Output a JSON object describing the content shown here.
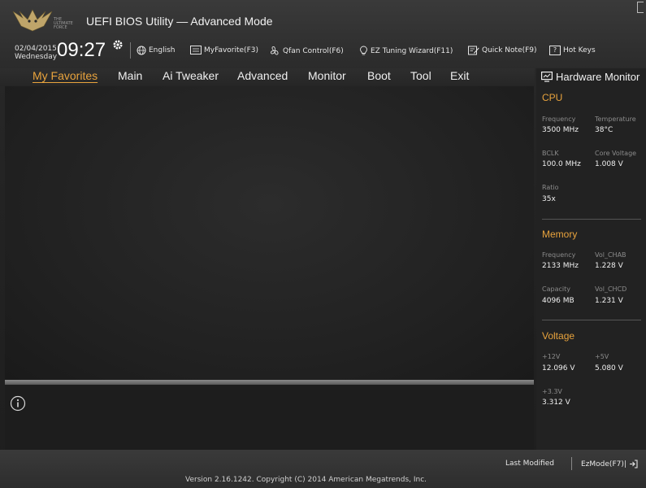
{
  "header": {
    "brand_small": "THE ULTIMATE FORCE",
    "app_title": "UEFI BIOS Utility — Advanced Mode"
  },
  "toolbar": {
    "date": "02/04/2015",
    "weekday": "Wednesday",
    "time": "09:27",
    "language": "English",
    "my_favorite": "MyFavorite(F3)",
    "qfan": "Qfan Control(F6)",
    "ez_tuning": "EZ Tuning Wizard(F11)",
    "quick_note": "Quick Note(F9)",
    "hot_keys": "Hot Keys",
    "hot_keys_key": "?"
  },
  "nav": {
    "items": [
      "My Favorites",
      "Main",
      "Ai Tweaker",
      "Advanced",
      "Monitor",
      "Boot",
      "Tool",
      "Exit"
    ],
    "active": "My Favorites"
  },
  "hardware_monitor": {
    "title": "Hardware Monitor",
    "cpu": {
      "heading": "CPU",
      "frequency_label": "Frequency",
      "frequency": "3500 MHz",
      "temperature_label": "Temperature",
      "temperature": "38°C",
      "bclk_label": "BCLK",
      "bclk": "100.0 MHz",
      "core_voltage_label": "Core Voltage",
      "core_voltage": "1.008 V",
      "ratio_label": "Ratio",
      "ratio": "35x"
    },
    "memory": {
      "heading": "Memory",
      "frequency_label": "Frequency",
      "frequency": "2133 MHz",
      "vol_chab_label": "Vol_CHAB",
      "vol_chab": "1.228 V",
      "capacity_label": "Capacity",
      "capacity": "4096 MB",
      "vol_chcd_label": "Vol_CHCD",
      "vol_chcd": "1.231 V"
    },
    "voltage": {
      "heading": "Voltage",
      "v12_label": "+12V",
      "v12": "12.096 V",
      "v5_label": "+5V",
      "v5": "5.080 V",
      "v33_label": "+3.3V",
      "v33": "3.312 V"
    }
  },
  "footer": {
    "last_modified": "Last Modified",
    "ez_mode": "EzMode(F7)|",
    "copyright": "Version 2.16.1242. Copyright (C) 2014 American Megatrends, Inc."
  },
  "colors": {
    "accent": "#e8a33d",
    "background": "#1e1e1e",
    "text": "#f0f0f0",
    "muted": "#8b8b8b"
  },
  "icons": [
    "logo-emblem",
    "gear-icon",
    "globe-icon",
    "favorite-icon",
    "fan-icon",
    "bulb-icon",
    "note-icon",
    "monitor-icon",
    "info-icon",
    "exit-icon"
  ]
}
